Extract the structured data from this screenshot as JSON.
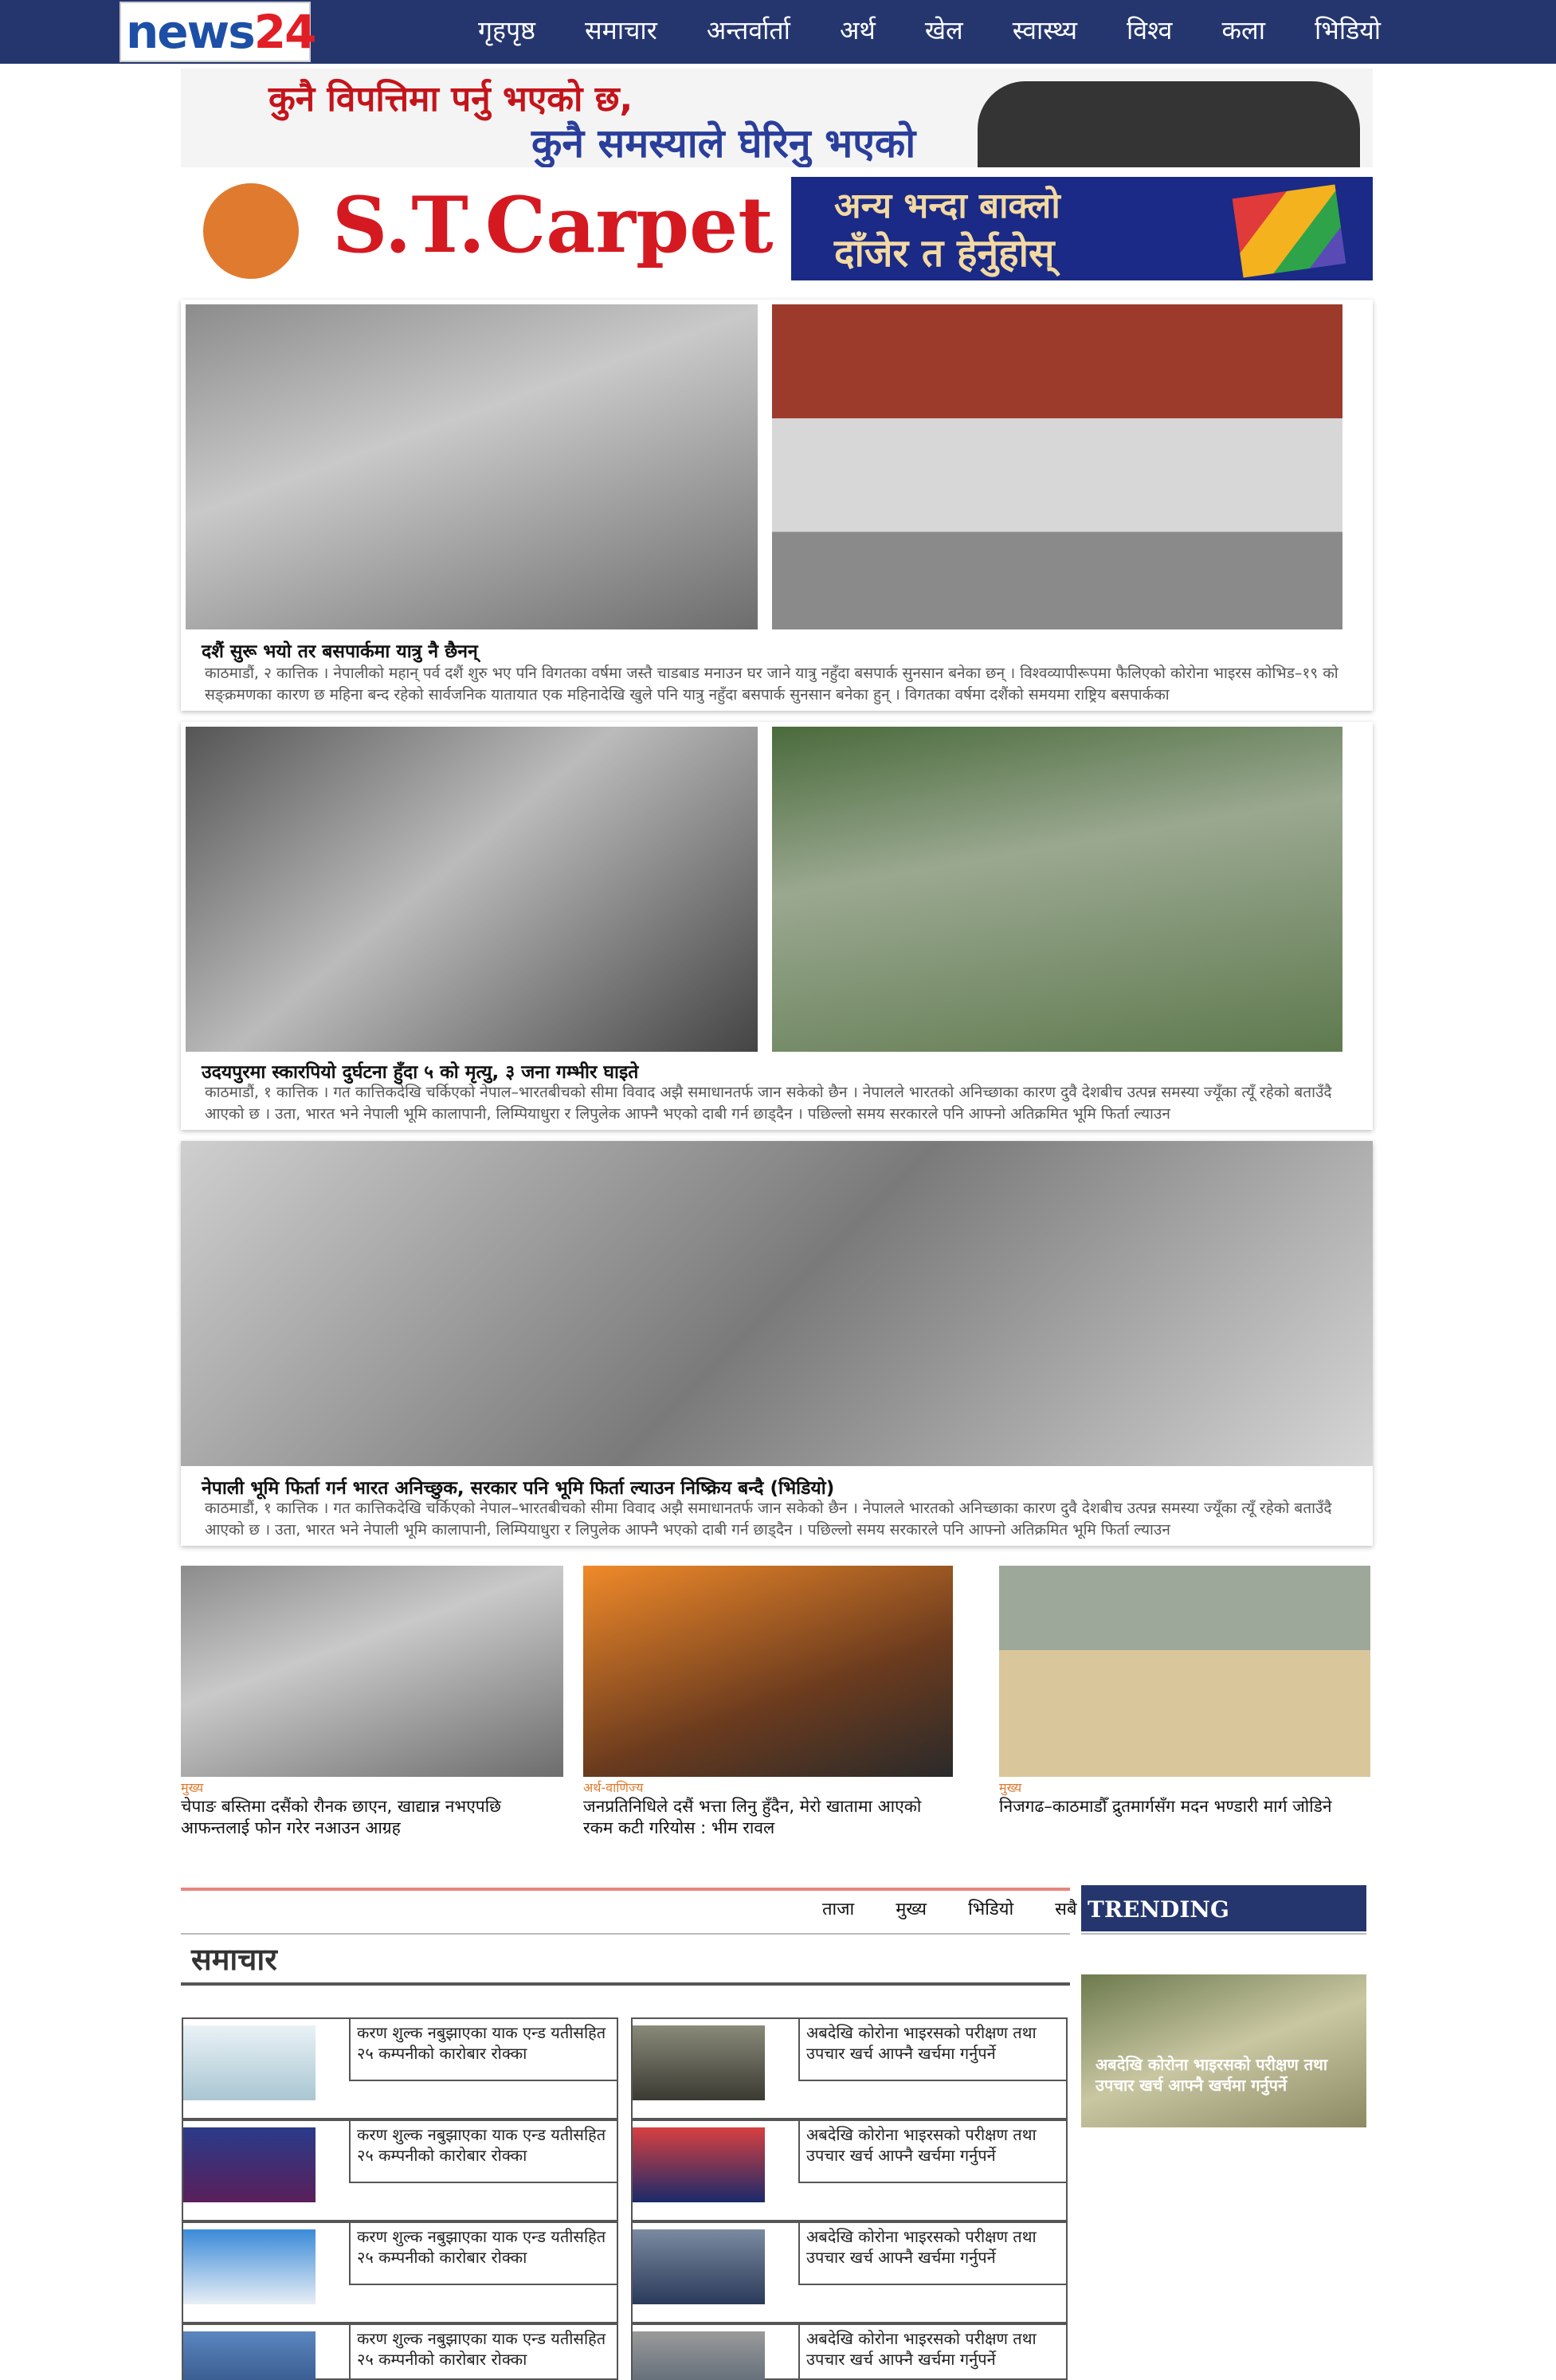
{
  "site": {
    "logo_main": "news",
    "logo_accent": "24"
  },
  "nav": {
    "items": [
      "गृहपृष्ठ",
      "समाचार",
      "अन्तर्वार्ता",
      "अर्थ",
      "खेल",
      "स्वास्थ्य",
      "विश्व",
      "कला",
      "भिडियो"
    ]
  },
  "ads": {
    "banner1_line1": "कुनै विपत्तिमा पर्नु भएको छ,",
    "banner1_line2": "कुनै समस्याले घेरिनु भएको",
    "banner2_brand": "S.T.Carpet",
    "banner2_tag1": "अन्य भन्दा बाक्लो",
    "banner2_tag2": "दाँजेर त हेर्नुहोस्"
  },
  "featured": [
    {
      "title": "दशैं सुरू भयो तर बसपार्कमा यात्रु नै छैनन्",
      "excerpt": "काठमाडौं, २ कात्तिक । नेपालीको महान् पर्व दशैं शुरु भए पनि विगतका वर्षमा जस्तै चाडबाड मनाउन घर जाने यात्रु नहुँदा बसपार्क सुनसान बनेका छन् । विश्वव्यापीरूपमा फैलिएको कोरोना भाइरस कोभिड–१९ को सङ्क्रमणका कारण छ महिना बन्द रहेको सार्वजनिक यातायात एक महिनादेखि खुले पनि यात्रु नहुँदा बसपार्क सुनसान बनेका हुन् । विगतका वर्षमा दशैंको समयमा राष्ट्रिय बसपार्कका"
    },
    {
      "title": "उदयपुरमा स्कारपियो दुर्घटना हुँदा ५ को मृत्यु, ३ जना गम्भीर घाइते",
      "excerpt": "काठमाडौं, १ कात्तिक । गत कात्तिकदेखि चर्किएको नेपाल–भारतबीचको सीमा विवाद अझै समाधानतर्फ जान सकेको छैन । नेपालले भारतको अनिच्छाका कारण दुवै देशबीच उत्पन्न समस्या ज्यूँका त्यूँ रहेको बताउँदै आएको छ । उता, भारत भने नेपाली भूमि कालापानी, लिम्पियाधुरा र लिपुलेक आफ्नै भएको दाबी गर्न छाड्दैन । पछिल्लो समय सरकारले पनि आफ्नो अतिक्रमित भूमि फिर्ता ल्याउन"
    },
    {
      "title": "नेपाली भूमि फिर्ता गर्न भारत अनिच्छुक, सरकार पनि भूमि फिर्ता ल्याउन निष्क्रिय बन्दै (भिडियो)",
      "excerpt": "काठमाडौं, १ कात्तिक । गत कात्तिकदेखि चर्किएको नेपाल–भारतबीचको सीमा विवाद अझै समाधानतर्फ जान सकेको छैन । नेपालले भारतको अनिच्छाका कारण दुवै देशबीच उत्पन्न समस्या ज्यूँका त्यूँ रहेको बताउँदै आएको छ । उता, भारत भने नेपाली भूमि कालापानी, लिम्पियाधुरा र लिपुलेक आफ्नै भएको दाबी गर्न छाड्दैन । पछिल्लो समय सरकारले पनि आफ्नो अतिक्रमित भूमि फिर्ता ल्याउन"
    }
  ],
  "cards": [
    {
      "category": "मुख्य",
      "title": "चेपाङ बस्तिमा दसैंको रौनक छाएन, खाद्यान्न नभएपछि आफन्तलाई फोन गरेर नआउन आग्रह"
    },
    {
      "category": "अर्थ-वाणिज्य",
      "title": "जनप्रतिनिधिले दसैं भत्ता लिनु हुँदैन, मेरो खातामा आएको रकम कटी गरियोस : भीम रावल"
    },
    {
      "category": "मुख्य",
      "title": "निजगढ–काठमाडौँ द्रुतमार्गसँग मदन भण्डारी मार्ग जोडिने"
    }
  ],
  "tabs": [
    "ताजा",
    "मुख्य",
    "भिडियो",
    "सबै"
  ],
  "section": {
    "title": "समाचार"
  },
  "news_left": [
    "करण शुल्क नबुझाएका याक एन्ड यतीसहित २५ कम्पनीको कारोबार रोक्का",
    "करण शुल्क नबुझाएका याक एन्ड यतीसहित २५ कम्पनीको कारोबार रोक्का",
    "करण शुल्क नबुझाएका याक एन्ड यतीसहित २५ कम्पनीको कारोबार रोक्का",
    "करण शुल्क नबुझाएका याक एन्ड यतीसहित २५ कम्पनीको कारोबार रोक्का"
  ],
  "news_right": [
    "अबदेखि कोरोना भाइरसको परीक्षण तथा उपचार खर्च आफ्नै खर्चमा गर्नुपर्ने",
    "अबदेखि कोरोना भाइरसको परीक्षण तथा उपचार खर्च आफ्नै खर्चमा गर्नुपर्ने",
    "अबदेखि कोरोना भाइरसको परीक्षण तथा उपचार खर्च आफ्नै खर्चमा गर्नुपर्ने",
    "अबदेखि कोरोना भाइरसको परीक्षण तथा उपचार खर्च आफ्नै खर्चमा गर्नुपर्ने"
  ],
  "trending": {
    "label": "TRENDING",
    "item": "अबदेखि कोरोना भाइरसको परीक्षण तथा उपचार खर्च आफ्नै खर्चमा गर्नुपर्ने"
  },
  "colors": {
    "brand_blue": "#25366f",
    "brand_red": "#e11e26",
    "accent_orange": "#e07a2f"
  }
}
